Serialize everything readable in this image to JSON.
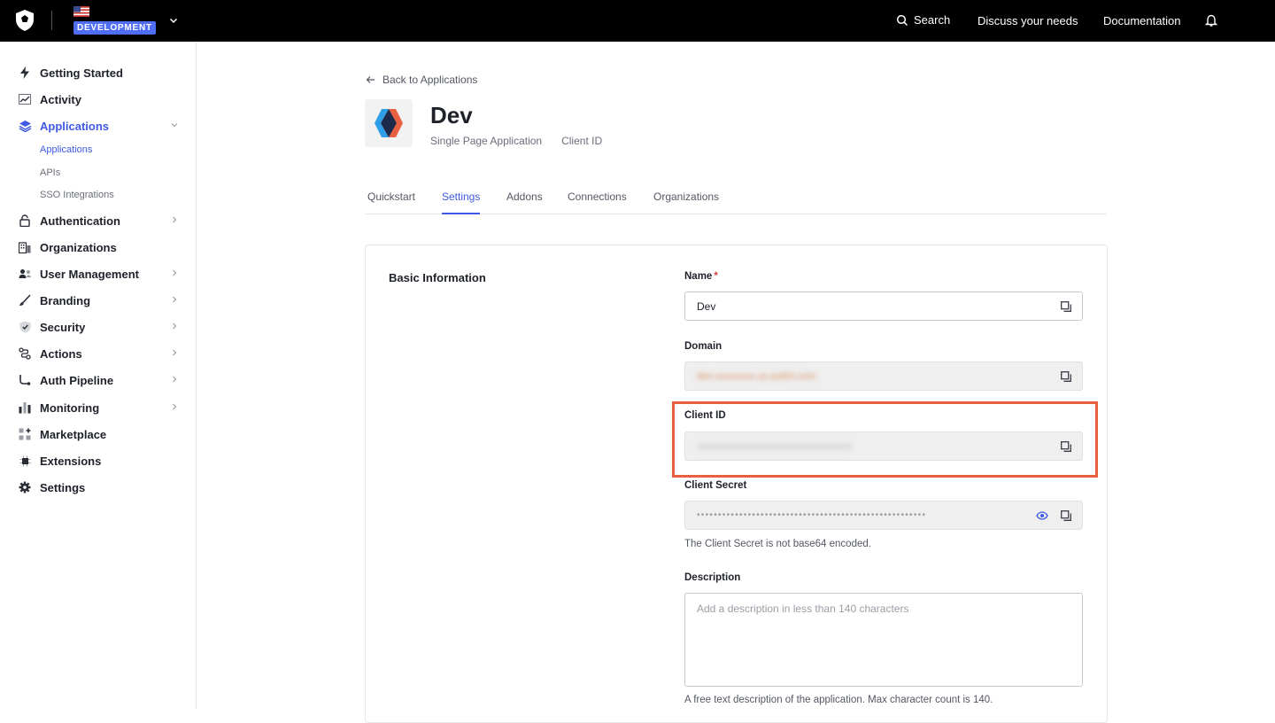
{
  "topbar": {
    "env_badge": "DEVELOPMENT",
    "search_label": "Search",
    "discuss_label": "Discuss your needs",
    "docs_label": "Documentation"
  },
  "sidebar": {
    "items": [
      {
        "label": "Getting Started",
        "icon": "bolt-icon"
      },
      {
        "label": "Activity",
        "icon": "activity-icon"
      },
      {
        "label": "Applications",
        "icon": "layers-icon"
      },
      {
        "label": "Authentication",
        "icon": "lock-icon"
      },
      {
        "label": "Organizations",
        "icon": "building-icon"
      },
      {
        "label": "User Management",
        "icon": "users-icon"
      },
      {
        "label": "Branding",
        "icon": "brush-icon"
      },
      {
        "label": "Security",
        "icon": "shield-icon"
      },
      {
        "label": "Actions",
        "icon": "flow-icon"
      },
      {
        "label": "Auth Pipeline",
        "icon": "pipeline-icon"
      },
      {
        "label": "Monitoring",
        "icon": "bar-chart-icon"
      },
      {
        "label": "Marketplace",
        "icon": "grid-plus-icon"
      },
      {
        "label": "Extensions",
        "icon": "chip-icon"
      },
      {
        "label": "Settings",
        "icon": "gear-icon"
      }
    ],
    "sub_items": [
      "Applications",
      "APIs",
      "SSO Integrations"
    ]
  },
  "main": {
    "back_label": "Back to Applications",
    "app_name": "Dev",
    "app_type": "Single Page Application",
    "client_id_label": "Client ID",
    "tabs": [
      "Quickstart",
      "Settings",
      "Addons",
      "Connections",
      "Organizations"
    ],
    "active_tab": "Settings"
  },
  "form": {
    "section_title": "Basic Information",
    "name_label": "Name",
    "name_required": "*",
    "name_value": "Dev",
    "domain_label": "Domain",
    "domain_value": "dev-xxxxxxxx.us.auth0.com",
    "client_id_label": "Client ID",
    "client_id_value": "xxxxxxxxxxxxxxxxxxxxxxxxxxxxxxxx",
    "client_secret_label": "Client Secret",
    "client_secret_value": "••••••••••••••••••••••••••••••••••••••••••••••••••••••",
    "client_secret_help": "The Client Secret is not base64 encoded.",
    "description_label": "Description",
    "description_placeholder": "Add a description in less than 140 characters",
    "description_help": "A free text description of the application. Max character count is 140."
  },
  "colors": {
    "accent": "#3f59e4",
    "highlight": "#e8603f",
    "env_badge": "#4f6df5"
  }
}
